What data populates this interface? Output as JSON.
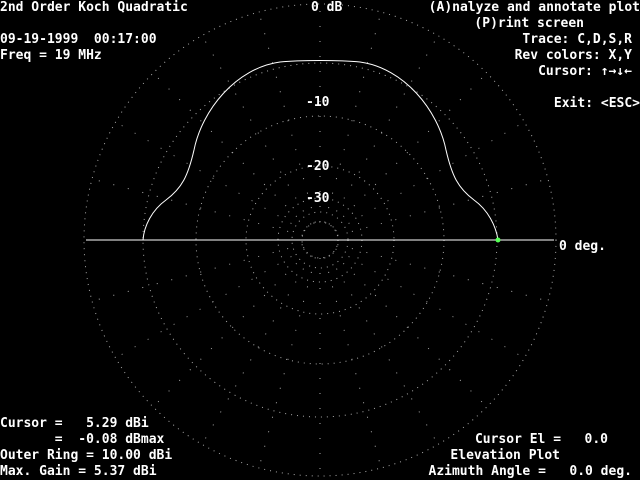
{
  "header": {
    "title": "2nd Order Koch Quadratic",
    "db_label": "0 dB",
    "date_time": "09-19-1999  00:17:00",
    "freq": "Freq = 19 MHz"
  },
  "menu": {
    "analyze": "(A)nalyze and annotate plot",
    "print": "(P)rint screen",
    "trace": "Trace: C,D,S,R",
    "rev_colors": "Rev colors: X,Y",
    "cursor_keys": "Cursor: ↑→↓←",
    "exit": "Exit: <ESC>"
  },
  "plot": {
    "ring_labels": [
      "-10",
      "-20",
      "-30"
    ],
    "zero_deg_label": "0 deg.",
    "colors": {
      "background": "#000000",
      "pattern": "#ffffff",
      "grid": "#aaaaaa",
      "cursor": "#55ff55"
    }
  },
  "footer": {
    "cursor_dbi": "Cursor =   5.29 dBi",
    "cursor_dbmax": "       =  -0.08 dBmax",
    "outer_ring": "Outer Ring = 10.00 dBi",
    "max_gain": "Max. Gain = 5.37 dBi",
    "cursor_el": "Cursor El =   0.0",
    "plot_type": "Elevation Plot",
    "azimuth": "Azimuth Angle =   0.0 deg."
  }
}
